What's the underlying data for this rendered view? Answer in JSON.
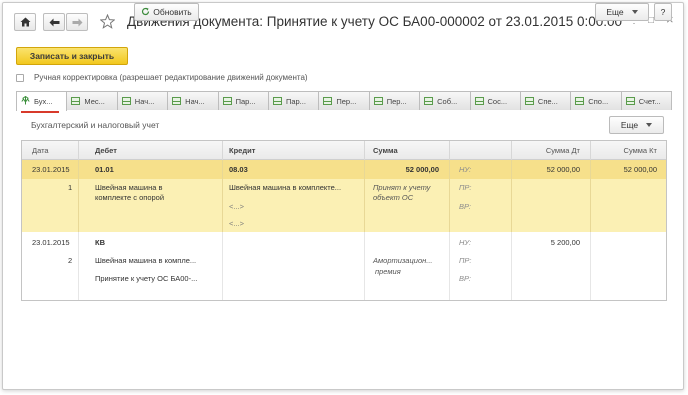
{
  "window": {
    "title": "Движения документа: Принятие к учету ОС БА00-000002 от 23.01.2015 0:00:00",
    "more_menu": "⋮",
    "maximize": "□",
    "close": "×"
  },
  "toolbar": {
    "save_close": "Записать и закрыть",
    "refresh": "Обновить",
    "more": "Еще",
    "help": "?"
  },
  "manual_adjust_label": "Ручная корректировка (разрешает редактирование движений документа)",
  "tabs": [
    {
      "label": "Бух..."
    },
    {
      "label": "Мес..."
    },
    {
      "label": "Нач..."
    },
    {
      "label": "Нач..."
    },
    {
      "label": "Пар..."
    },
    {
      "label": "Пар..."
    },
    {
      "label": "Пер..."
    },
    {
      "label": "Пер..."
    },
    {
      "label": "Соб..."
    },
    {
      "label": "Сос..."
    },
    {
      "label": "Спе..."
    },
    {
      "label": "Спо..."
    },
    {
      "label": "Счет..."
    }
  ],
  "section_title": "Бухгалтерский и налоговый учет",
  "grid_more": "Еще",
  "columns": {
    "date": "Дата",
    "debit": "Дебет",
    "credit": "Кредит",
    "amount": "Сумма",
    "amount_dt": "Сумма Дт",
    "amount_kt": "Сумма Кт"
  },
  "entries": [
    {
      "date": "23.01.2015",
      "num": "1",
      "debit_account": "01.01",
      "debit_sub1": "Швейная машина в",
      "debit_sub2": "комплекте с опорой",
      "credit_account": "08.03",
      "credit_sub1": "Швейная машина в комплекте...",
      "credit_sub2": "<...>",
      "credit_sub3": "<...>",
      "amount": "52 000,00",
      "content1": "Принят к учету",
      "content2": "объект ОС",
      "nu": "НУ:",
      "pr": "ПР:",
      "vr": "ВР:",
      "sum_dt": "52 000,00",
      "sum_kt": "52 000,00"
    },
    {
      "date": "23.01.2015",
      "num": "2",
      "debit_account": "КВ",
      "debit_sub1": "Швейная машина в компле...",
      "debit_sub2": "Принятие к учету ОС БА00-...",
      "content1": "Амортизацион...",
      "content2": "премия",
      "nu": "НУ:",
      "pr": "ПР:",
      "vr": "ВР:",
      "sum_dt": "5 200,00"
    }
  ]
}
